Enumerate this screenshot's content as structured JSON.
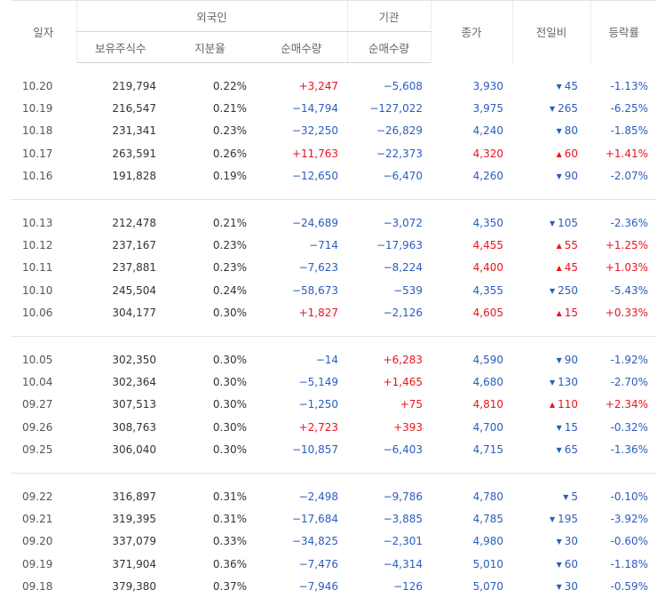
{
  "header": {
    "date": "일자",
    "foreign": "외국인",
    "institution": "기관",
    "holdings": "보유주식수",
    "ratio": "지분율",
    "foreign_net": "순매수량",
    "inst_net": "순매수량",
    "close": "종가",
    "change": "전일비",
    "rate": "등락률"
  },
  "colors": {
    "up": "#e8141e",
    "down": "#2a5dbf"
  },
  "groups": [
    [
      {
        "date": "10.20",
        "holdings": "219,794",
        "ratio": "0.22%",
        "foreign_net": "+3,247",
        "inst_net": "−5,608",
        "close": "3,930",
        "change": "45",
        "dir": "down",
        "rate": "-1.13%"
      },
      {
        "date": "10.19",
        "holdings": "216,547",
        "ratio": "0.21%",
        "foreign_net": "−14,794",
        "inst_net": "−127,022",
        "close": "3,975",
        "change": "265",
        "dir": "down",
        "rate": "-6.25%"
      },
      {
        "date": "10.18",
        "holdings": "231,341",
        "ratio": "0.23%",
        "foreign_net": "−32,250",
        "inst_net": "−26,829",
        "close": "4,240",
        "change": "80",
        "dir": "down",
        "rate": "-1.85%"
      },
      {
        "date": "10.17",
        "holdings": "263,591",
        "ratio": "0.26%",
        "foreign_net": "+11,763",
        "inst_net": "−22,373",
        "close": "4,320",
        "change": "60",
        "dir": "up",
        "rate": "+1.41%"
      },
      {
        "date": "10.16",
        "holdings": "191,828",
        "ratio": "0.19%",
        "foreign_net": "−12,650",
        "inst_net": "−6,470",
        "close": "4,260",
        "change": "90",
        "dir": "down",
        "rate": "-2.07%"
      }
    ],
    [
      {
        "date": "10.13",
        "holdings": "212,478",
        "ratio": "0.21%",
        "foreign_net": "−24,689",
        "inst_net": "−3,072",
        "close": "4,350",
        "change": "105",
        "dir": "down",
        "rate": "-2.36%"
      },
      {
        "date": "10.12",
        "holdings": "237,167",
        "ratio": "0.23%",
        "foreign_net": "−714",
        "inst_net": "−17,963",
        "close": "4,455",
        "change": "55",
        "dir": "up",
        "rate": "+1.25%"
      },
      {
        "date": "10.11",
        "holdings": "237,881",
        "ratio": "0.23%",
        "foreign_net": "−7,623",
        "inst_net": "−8,224",
        "close": "4,400",
        "change": "45",
        "dir": "up",
        "rate": "+1.03%"
      },
      {
        "date": "10.10",
        "holdings": "245,504",
        "ratio": "0.24%",
        "foreign_net": "−58,673",
        "inst_net": "−539",
        "close": "4,355",
        "change": "250",
        "dir": "down",
        "rate": "-5.43%"
      },
      {
        "date": "10.06",
        "holdings": "304,177",
        "ratio": "0.30%",
        "foreign_net": "+1,827",
        "inst_net": "−2,126",
        "close": "4,605",
        "change": "15",
        "dir": "up",
        "rate": "+0.33%"
      }
    ],
    [
      {
        "date": "10.05",
        "holdings": "302,350",
        "ratio": "0.30%",
        "foreign_net": "−14",
        "inst_net": "+6,283",
        "close": "4,590",
        "change": "90",
        "dir": "down",
        "rate": "-1.92%"
      },
      {
        "date": "10.04",
        "holdings": "302,364",
        "ratio": "0.30%",
        "foreign_net": "−5,149",
        "inst_net": "+1,465",
        "close": "4,680",
        "change": "130",
        "dir": "down",
        "rate": "-2.70%"
      },
      {
        "date": "09.27",
        "holdings": "307,513",
        "ratio": "0.30%",
        "foreign_net": "−1,250",
        "inst_net": "+75",
        "close": "4,810",
        "change": "110",
        "dir": "up",
        "rate": "+2.34%"
      },
      {
        "date": "09.26",
        "holdings": "308,763",
        "ratio": "0.30%",
        "foreign_net": "+2,723",
        "inst_net": "+393",
        "close": "4,700",
        "change": "15",
        "dir": "down",
        "rate": "-0.32%"
      },
      {
        "date": "09.25",
        "holdings": "306,040",
        "ratio": "0.30%",
        "foreign_net": "−10,857",
        "inst_net": "−6,403",
        "close": "4,715",
        "change": "65",
        "dir": "down",
        "rate": "-1.36%"
      }
    ],
    [
      {
        "date": "09.22",
        "holdings": "316,897",
        "ratio": "0.31%",
        "foreign_net": "−2,498",
        "inst_net": "−9,786",
        "close": "4,780",
        "change": "5",
        "dir": "down",
        "rate": "-0.10%"
      },
      {
        "date": "09.21",
        "holdings": "319,395",
        "ratio": "0.31%",
        "foreign_net": "−17,684",
        "inst_net": "−3,885",
        "close": "4,785",
        "change": "195",
        "dir": "down",
        "rate": "-3.92%"
      },
      {
        "date": "09.20",
        "holdings": "337,079",
        "ratio": "0.33%",
        "foreign_net": "−34,825",
        "inst_net": "−2,301",
        "close": "4,980",
        "change": "30",
        "dir": "down",
        "rate": "-0.60%"
      },
      {
        "date": "09.19",
        "holdings": "371,904",
        "ratio": "0.36%",
        "foreign_net": "−7,476",
        "inst_net": "−4,314",
        "close": "5,010",
        "change": "60",
        "dir": "down",
        "rate": "-1.18%"
      },
      {
        "date": "09.18",
        "holdings": "379,380",
        "ratio": "0.37%",
        "foreign_net": "−7,946",
        "inst_net": "−126",
        "close": "5,070",
        "change": "30",
        "dir": "down",
        "rate": "-0.59%"
      }
    ]
  ]
}
